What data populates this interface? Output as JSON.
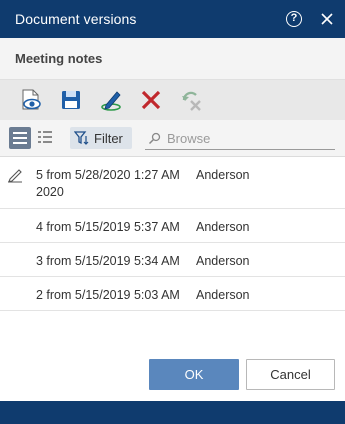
{
  "dialog": {
    "title": "Document versions",
    "help_icon": "question-circle-icon",
    "close_icon": "close-icon"
  },
  "document": {
    "name": "Meeting notes"
  },
  "toolbar": {
    "buttons": [
      {
        "icon": "view-document-icon"
      },
      {
        "icon": "save-icon"
      },
      {
        "icon": "edit-version-icon"
      },
      {
        "icon": "delete-icon"
      },
      {
        "icon": "restore-disabled-icon"
      }
    ]
  },
  "filterbar": {
    "filter_label": "Filter",
    "search_placeholder": "Browse"
  },
  "versions": [
    {
      "line1": "5 from 5/28/2020 1:27 AM",
      "line2": "2020",
      "user": "Anderson",
      "current": true
    },
    {
      "line1": "4 from 5/15/2019 5:37 AM",
      "user": "Anderson"
    },
    {
      "line1": "3 from 5/15/2019 5:34 AM",
      "user": "Anderson"
    },
    {
      "line1": "2 from 5/15/2019 5:03 AM",
      "user": "Anderson"
    }
  ],
  "footer": {
    "ok_label": "OK",
    "cancel_label": "Cancel"
  },
  "colors": {
    "titlebar": "#0f3b6e",
    "accent": "#5a87bd",
    "delete": "#c0282d",
    "save": "#1f5fa8"
  }
}
